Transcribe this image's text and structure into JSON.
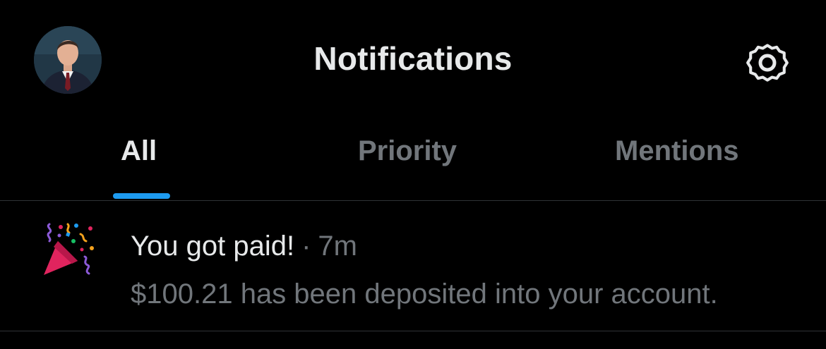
{
  "header": {
    "title": "Notifications",
    "avatar_icon": "profile-avatar",
    "settings_icon": "gear-icon"
  },
  "tabs": [
    {
      "label": "All",
      "active": true
    },
    {
      "label": "Priority",
      "active": false
    },
    {
      "label": "Mentions",
      "active": false
    }
  ],
  "notifications": [
    {
      "icon": "party-popper-icon",
      "title": "You got paid!",
      "separator": "·",
      "time": "7m",
      "body": "$100.21 has been deposited into your account."
    }
  ],
  "colors": {
    "background": "#000000",
    "primary_text": "#e7e9ea",
    "secondary_text": "#71767b",
    "accent": "#1d9bf0",
    "divider": "#2f3336"
  }
}
